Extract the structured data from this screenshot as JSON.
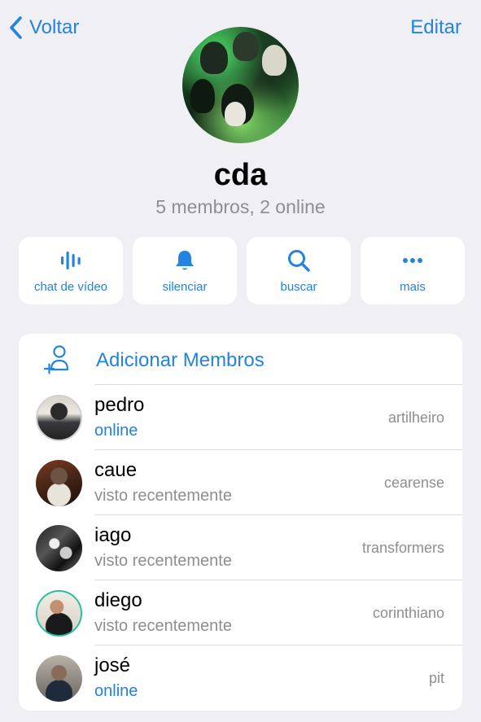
{
  "header": {
    "back_label": "Voltar",
    "edit_label": "Editar"
  },
  "group": {
    "title": "cda",
    "subtitle": "5 membros, 2 online"
  },
  "actions": [
    {
      "icon": "video-waveform-icon",
      "label": "chat de vídeo"
    },
    {
      "icon": "bell-icon",
      "label": "silenciar"
    },
    {
      "icon": "search-icon",
      "label": "buscar"
    },
    {
      "icon": "more-dots-icon",
      "label": "mais"
    }
  ],
  "members_card": {
    "add_label": "Adicionar Membros",
    "members": [
      {
        "name": "pedro",
        "status": "online",
        "role": "artilheiro"
      },
      {
        "name": "caue",
        "status": "visto recentemente",
        "role": "cearense"
      },
      {
        "name": "iago",
        "status": "visto recentemente",
        "role": "transformers"
      },
      {
        "name": "diego",
        "status": "visto recentemente",
        "role": "corinthiano"
      },
      {
        "name": "josé",
        "status": "online",
        "role": "pit"
      }
    ]
  },
  "colors": {
    "accent": "#2383e0",
    "background": "#efeff4",
    "secondary_text": "#8e8e93"
  }
}
